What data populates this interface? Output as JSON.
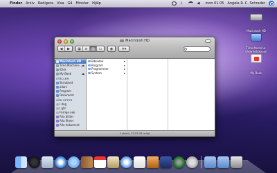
{
  "menubar": {
    "apple_glyph": "",
    "items": [
      "Finder",
      "Arkiv",
      "Redigera",
      "Visa",
      "Gå",
      "Fönster",
      "Hjälp"
    ],
    "clock": "mon 01.05",
    "user": "Angela R. C. Schrader"
  },
  "desktop": {
    "icons": [
      {
        "label": "Macintosh HD"
      },
      {
        "label": "Time Machine-säkerhetskopior"
      },
      {
        "label": "My Book"
      }
    ]
  },
  "window": {
    "title": "Macintosh HD",
    "search_placeholder": "",
    "sidebar": {
      "devices": [
        {
          "label": "Macintosh HD",
          "selected": true
        },
        {
          "label": "Time Machine-...",
          "eject": "⏏"
        },
        {
          "label": "iDisk"
        },
        {
          "label": "My Book",
          "eject": "⏏"
        }
      ],
      "places_header": "STÄLLEN",
      "places": [
        "Skrivbord",
        "aliani",
        "Program",
        "Dokument"
      ],
      "search_header": "SÖK EFTER",
      "searches": [
        "I dag",
        "I går",
        "Förrige vek",
        "Alla bilder",
        "Alla filmer",
        "Alla dokument"
      ]
    },
    "column1": [
      "Bibliotek",
      "Program",
      "Programmer",
      "System"
    ],
    "status": "4 objekt, 37,03 GB ledigt"
  },
  "dock": {
    "apps": [
      "Finder",
      "Dashboard",
      "Mail",
      "Safari",
      "iChat",
      "Adressbok",
      "iCal",
      "Förhandsvisning",
      "iTunes",
      "iPhoto",
      "GarageBand",
      "Spaces",
      "Time Machine",
      "Systeminställningar",
      "Program",
      "Dokument",
      "Papperskorg"
    ]
  }
}
